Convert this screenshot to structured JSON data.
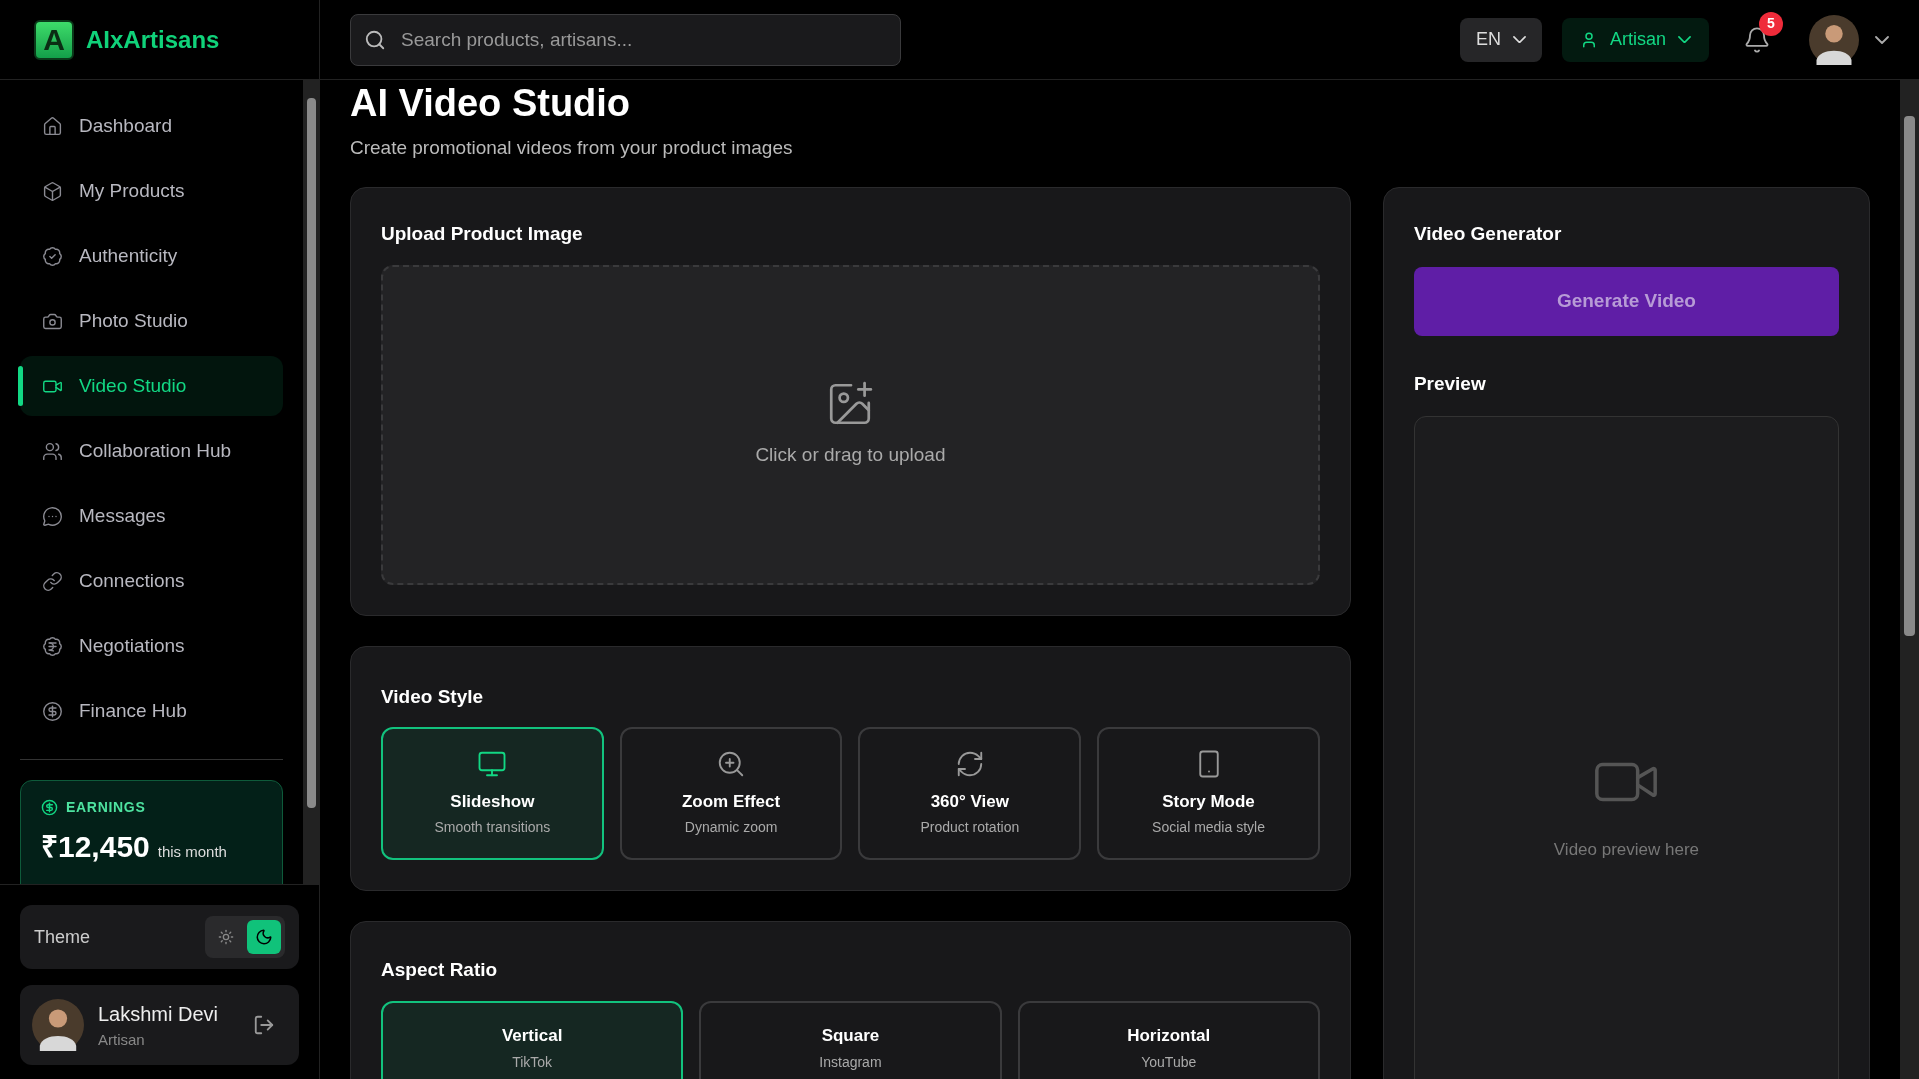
{
  "brand": {
    "logo_letter": "A",
    "name": "AIxArtisans"
  },
  "sidebar": {
    "items": [
      {
        "label": "Dashboard",
        "selected": false
      },
      {
        "label": "My Products",
        "selected": false
      },
      {
        "label": "Authenticity",
        "selected": false
      },
      {
        "label": "Photo Studio",
        "selected": false
      },
      {
        "label": "Video Studio",
        "selected": true
      },
      {
        "label": "Collaboration Hub",
        "selected": false
      },
      {
        "label": "Messages",
        "selected": false
      },
      {
        "label": "Connections",
        "selected": false
      },
      {
        "label": "Negotiations",
        "selected": false
      },
      {
        "label": "Finance Hub",
        "selected": false
      }
    ],
    "earnings": {
      "label": "EARNINGS",
      "amount": "₹12,450",
      "period": "this month"
    },
    "theme": {
      "label": "Theme",
      "dark": true
    },
    "user": {
      "name": "Lakshmi Devi",
      "role": "Artisan"
    }
  },
  "header": {
    "search": {
      "placeholder": "Search products, artisans..."
    },
    "language": "EN",
    "role": "Artisan",
    "notifications": "5"
  },
  "page": {
    "title": "AI Video Studio",
    "subtitle": "Create promotional videos from your product images"
  },
  "upload": {
    "title": "Upload Product Image",
    "hint": "Click or drag to upload"
  },
  "video_style": {
    "title": "Video Style",
    "options": [
      {
        "title": "Slideshow",
        "subtitle": "Smooth transitions",
        "selected": true
      },
      {
        "title": "Zoom Effect",
        "subtitle": "Dynamic zoom",
        "selected": false
      },
      {
        "title": "360° View",
        "subtitle": "Product rotation",
        "selected": false
      },
      {
        "title": "Story Mode",
        "subtitle": "Social media style",
        "selected": false
      }
    ]
  },
  "aspect_ratio": {
    "title": "Aspect Ratio",
    "options": [
      {
        "title": "Vertical",
        "subtitle": "TikTok",
        "selected": true
      },
      {
        "title": "Square",
        "subtitle": "Instagram",
        "selected": false
      },
      {
        "title": "Horizontal",
        "subtitle": "YouTube",
        "selected": false
      }
    ]
  },
  "generator": {
    "title": "Video Generator",
    "button": "Generate Video",
    "disabled": true,
    "preview_title": "Preview",
    "preview_hint": "Video preview here"
  }
}
